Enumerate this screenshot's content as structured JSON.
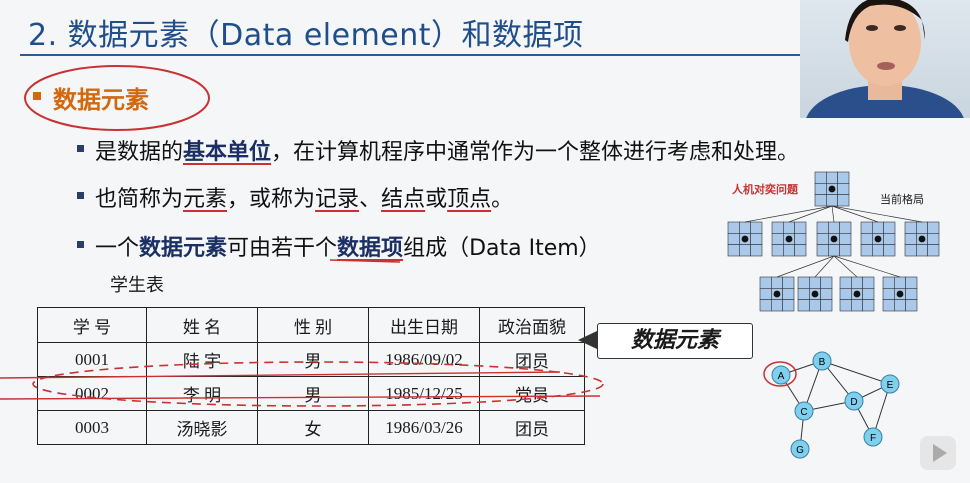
{
  "slide": {
    "title": "2. 数据元素（Data element）和数据项",
    "section": "数据元素",
    "bullets": {
      "b1": {
        "p1": "是数据的",
        "p2": "基本单位",
        "p3": "，在计算机程序中通常作为一个整体进行考虑和处理。"
      },
      "b2": {
        "p1": "也简称为",
        "p2": "元素",
        "p3": "，或称为",
        "p4": "记录",
        "p5": "、",
        "p6": "结点",
        "p7": "或",
        "p8": "顶点",
        "p9": "。"
      },
      "b3": {
        "p1": "一个",
        "p2": "数据元素",
        "p3": "可由若干个",
        "p4": "数据项",
        "p5": "组成（Data Item）"
      }
    },
    "table_caption": "学生表",
    "table": {
      "headers": [
        "学  号",
        "姓  名",
        "性  别",
        "出生日期",
        "政治面貌"
      ],
      "rows": [
        [
          "0001",
          "陆  宇",
          "男",
          "1986/09/02",
          "团员"
        ],
        [
          "0002",
          "李  明",
          "男",
          "1985/12/25",
          "党员"
        ],
        [
          "0003",
          "汤晓影",
          "女",
          "1986/03/26",
          "团员"
        ]
      ]
    },
    "badge": "数据元素",
    "tree": {
      "title": "人机对奕问题",
      "current": "当前格局"
    },
    "graph_nodes": [
      "A",
      "B",
      "C",
      "D",
      "E",
      "F",
      "G"
    ]
  },
  "colors": {
    "title": "#1f4e8a",
    "accent": "#d2690f",
    "annotation": "#c83232",
    "node": "#7fd0ef"
  }
}
